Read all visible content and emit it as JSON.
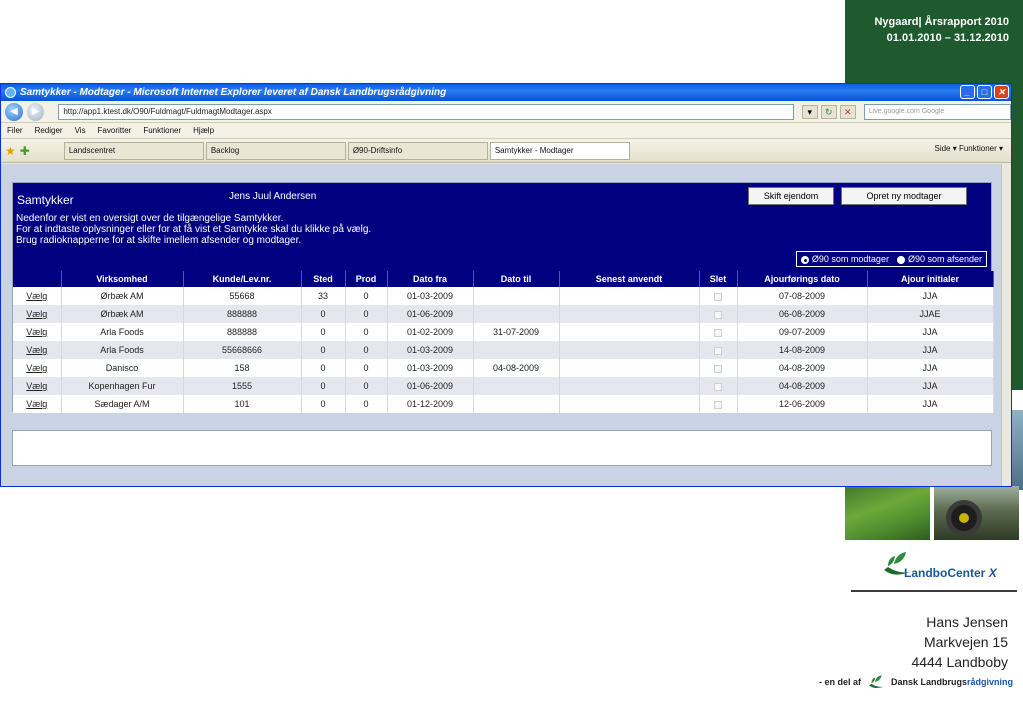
{
  "slide": {
    "report_title": "Nygaard| Årsrapport 2010",
    "report_period": "01.01.2010 – 31.12.2010",
    "logo_text": "LandboCenter",
    "logo_suffix": "X",
    "address": {
      "name": "Hans Jensen",
      "street": "Markvejen 15",
      "city": "4444 Landboby"
    },
    "footer_prefix": "- en del af",
    "footer_brand_main": "Dansk Landbrugs",
    "footer_brand_accent": "rådgivning"
  },
  "browser": {
    "window_title": "Samtykker - Modtager - Microsoft Internet Explorer leveret af Dansk Landbrugsrådgivning",
    "url": "http://app1.ktest.dk/O90/Fuldmagt/FuldmagtModtager.aspx",
    "search_placeholder": "Live.google.com Google",
    "menu": [
      "Filer",
      "Rediger",
      "Vis",
      "Favoritter",
      "Funktioner",
      "Hjælp"
    ],
    "tabs": [
      {
        "label": "Landscentret",
        "active": false
      },
      {
        "label": "Backlog",
        "active": false
      },
      {
        "label": "Ø90-Driftsinfo",
        "active": false
      },
      {
        "label": "Samtykker - Modtager",
        "active": true
      }
    ],
    "tools": "Side ▾  Funktioner ▾"
  },
  "app": {
    "title": "Samtykker",
    "user": "Jens Juul Andersen",
    "btn_change": "Skift ejendom",
    "btn_new": "Opret ny modtager",
    "info_lines": [
      "Nedenfor er vist en oversigt over de tilgængelige Samtykker.",
      "For at indtaste oplysninger eller for at få vist et Samtykke skal du klikke på vælg.",
      "Brug radioknapperne for at skifte imellem afsender og modtager."
    ],
    "radio_receiver": "Ø90 som modtager",
    "radio_sender": "Ø90 som afsender",
    "columns": [
      "",
      "Virksomhed",
      "Kunde/Lev.nr.",
      "Sted",
      "Prod",
      "Dato fra",
      "Dato til",
      "Senest anvendt",
      "Slet",
      "Ajourførings dato",
      "Ajour initialer"
    ],
    "select_label": "Vælg",
    "rows": [
      {
        "company": "Ørbæk AM",
        "customer": "55668",
        "place": "33",
        "prod": "0",
        "from": "01-03-2009",
        "to": "",
        "last_used": "",
        "updated": "07-08-2009",
        "initials": "JJA"
      },
      {
        "company": "Ørbæk AM",
        "customer": "888888",
        "place": "0",
        "prod": "0",
        "from": "01-06-2009",
        "to": "",
        "last_used": "",
        "updated": "06-08-2009",
        "initials": "JJAE"
      },
      {
        "company": "Arla Foods",
        "customer": "888888",
        "place": "0",
        "prod": "0",
        "from": "01-02-2009",
        "to": "31-07-2009",
        "last_used": "",
        "updated": "09-07-2009",
        "initials": "JJA"
      },
      {
        "company": "Arla Foods",
        "customer": "55668666",
        "place": "0",
        "prod": "0",
        "from": "01-03-2009",
        "to": "",
        "last_used": "",
        "updated": "14-08-2009",
        "initials": "JJA"
      },
      {
        "company": "Danisco",
        "customer": "158",
        "place": "0",
        "prod": "0",
        "from": "01-03-2009",
        "to": "04-08-2009",
        "last_used": "",
        "updated": "04-08-2009",
        "initials": "JJA"
      },
      {
        "company": "Kopenhagen Fur",
        "customer": "1555",
        "place": "0",
        "prod": "0",
        "from": "01-06-2009",
        "to": "",
        "last_used": "",
        "updated": "04-08-2009",
        "initials": "JJA"
      },
      {
        "company": "Sædager A/M",
        "customer": "101",
        "place": "0",
        "prod": "0",
        "from": "01-12-2009",
        "to": "",
        "last_used": "",
        "updated": "12-06-2009",
        "initials": "JJA"
      }
    ]
  }
}
